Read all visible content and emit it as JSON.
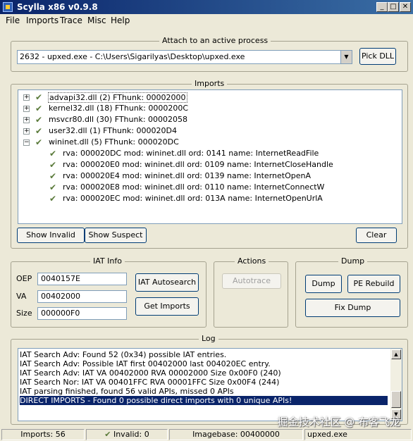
{
  "window": {
    "title": "Scylla x86 v0.9.8"
  },
  "menu": [
    "File",
    "Imports",
    "Trace",
    "Misc",
    "Help"
  ],
  "attach": {
    "group_title": "Attach to an active process",
    "process": "2632 - upxed.exe - C:\\Users\\Sigarilyas\\Desktop\\upxed.exe",
    "pick_dll": "Pick DLL"
  },
  "imports": {
    "group_title": "Imports",
    "modules": [
      "advapi32.dll (2) FThunk: 00002000",
      "kernel32.dll (18) FThunk: 0000200C",
      "msvcr80.dll (30) FThunk: 00002058",
      "user32.dll (1) FThunk: 000020D4",
      "wininet.dll (5) FThunk: 000020DC"
    ],
    "wininet_children": [
      "rva: 000020DC mod: wininet.dll ord: 0141 name: InternetReadFile",
      "rva: 000020E0 mod: wininet.dll ord: 0109 name: InternetCloseHandle",
      "rva: 000020E4 mod: wininet.dll ord: 0139 name: InternetOpenA",
      "rva: 000020E8 mod: wininet.dll ord: 0110 name: InternetConnectW",
      "rva: 000020EC mod: wininet.dll ord: 013A name: InternetOpenUrlA"
    ],
    "show_invalid": "Show Invalid",
    "show_suspect": "Show Suspect",
    "clear": "Clear"
  },
  "iat": {
    "group_title": "IAT Info",
    "oep_label": "OEP",
    "oep": "0040157E",
    "va_label": "VA",
    "va": "00402000",
    "size_label": "Size",
    "size": "000000F0",
    "autosearch": "IAT Autosearch",
    "get_imports": "Get Imports"
  },
  "actions": {
    "group_title": "Actions",
    "autotrace": "Autotrace"
  },
  "dump": {
    "group_title": "Dump",
    "dump": "Dump",
    "pe_rebuild": "PE Rebuild",
    "fix_dump": "Fix Dump"
  },
  "log": {
    "group_title": "Log",
    "lines": [
      "IAT Search Adv: Found 52 (0x34) possible IAT entries.",
      "IAT Search Adv: Possible IAT first 00402000 last 004020EC entry.",
      "IAT Search Adv: IAT VA 00402000 RVA 00002000 Size 0x00F0 (240)",
      "IAT Search Nor: IAT VA 00401FFC RVA 00001FFC Size 0x00F4 (244)",
      "IAT parsing finished, found 56 valid APIs, missed 0 APIs",
      "DIRECT IMPORTS - Found 0 possible direct imports with 0 unique APIs!"
    ]
  },
  "status": {
    "imports": "Imports: 56",
    "invalid": "Invalid: 0",
    "imagebase": "Imagebase: 00400000",
    "module": "upxed.exe"
  },
  "watermark": "掘金技术社区 @ 布客飞龙"
}
